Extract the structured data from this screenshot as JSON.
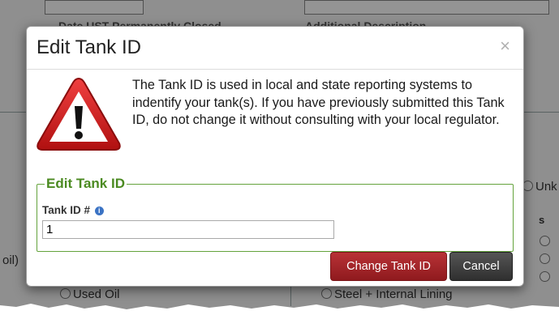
{
  "background": {
    "top_label_left": "Date UST Permanently Closed",
    "top_label_right": "Additional Description",
    "left_fragment": "oil)",
    "right_fragment_top": "Unk",
    "right_fragment_s": "s",
    "bottom_left_radio": "Used Oil",
    "bottom_right_radio": "Steel + Internal Lining"
  },
  "modal": {
    "title": "Edit Tank ID",
    "close_symbol": "×",
    "message": "The Tank ID is used in local and state reporting systems to indentify your tank(s). If you have previously submitted this Tank ID, do not change it without consulting with your local regulator.",
    "fieldset_legend": "Edit Tank ID",
    "field_label": "Tank ID #",
    "info_symbol": "i",
    "field_value": "1",
    "primary_button": "Change Tank ID",
    "cancel_button": "Cancel"
  },
  "colors": {
    "legend_green": "#4b8a21",
    "fieldset_border": "#64a33c",
    "primary_red": "#a8282c",
    "cancel_dark": "#3a3a3a",
    "warning_red": "#cc1f1f"
  },
  "icons": {
    "warning": "warning-triangle-icon",
    "info": "info-icon",
    "close": "close-icon"
  }
}
